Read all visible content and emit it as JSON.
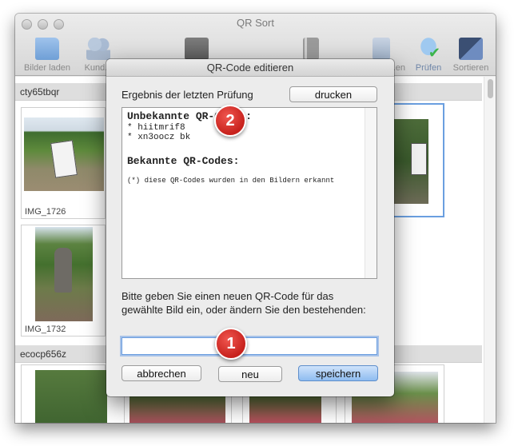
{
  "window": {
    "title": "QR Sort"
  },
  "toolbar": {
    "items": [
      {
        "label": "Bilder laden",
        "icon": "folder-icon"
      },
      {
        "label": "Kund...",
        "icon": "users-icon"
      },
      {
        "label": "",
        "icon": "printer-qr-icon"
      },
      {
        "label": "",
        "icon": "trash-icon"
      },
      {
        "label": "...en",
        "icon": "export-icon"
      },
      {
        "label": "Prüfen",
        "icon": "cloud-check-icon"
      },
      {
        "label": "Sortieren",
        "icon": "sort-arrow-icon"
      }
    ]
  },
  "groups": [
    {
      "name": "cty65tbqr",
      "images": [
        "IMG_1726",
        "IMG_1732"
      ]
    },
    {
      "name": "ecocp656z",
      "images": []
    }
  ],
  "dialog": {
    "title": "QR-Code editieren",
    "result_label": "Ergebnis der letzten Prüfung",
    "print_button": "drucken",
    "unknown_heading": "Unbekannte QR-Codes:",
    "unknown_codes": [
      "* hiitmrif8",
      "* xn3oocz bk"
    ],
    "known_heading": "Bekannte QR-Codes:",
    "footnote": "(*) diese QR-Codes wurden in den Bildern erkannt",
    "prompt": "Bitte geben Sie einen neuen QR-Code für das gewählte Bild ein, oder ändern Sie den bestehenden:",
    "input_value": "",
    "cancel_button": "abbrechen",
    "new_button": "neu",
    "save_button": "speichern"
  },
  "badges": {
    "one": "1",
    "two": "2"
  },
  "colors": {
    "accent": "#6a9fe0",
    "badge": "#d6302a",
    "primary_button": "#8ebcf0"
  }
}
